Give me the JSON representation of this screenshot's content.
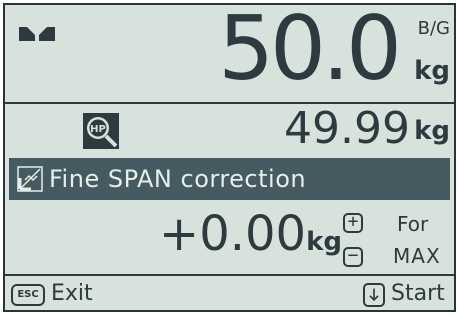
{
  "main_display": {
    "weight": "50.0",
    "mode": "B/G",
    "unit": "kg",
    "indicator_icon": "stable-indicator-icon"
  },
  "secondary_display": {
    "icon": "high-precision-magnifier-icon",
    "weight": "49.99",
    "unit": "kg"
  },
  "menu": {
    "icon": "span-adjust-icon",
    "title": "Fine SPAN correction"
  },
  "correction": {
    "value": "+0.00",
    "unit": "kg",
    "plus_key": "+",
    "minus_key": "−",
    "for_label": "For",
    "target_label": "MAX"
  },
  "softkeys": {
    "left_key": "ESC",
    "left_label": "Exit",
    "left_icon": "esc-key-icon",
    "right_icon": "down-arrow-key-icon",
    "right_label": "Start"
  },
  "colors": {
    "lcd_background": "#d8e2dc",
    "foreground": "#2e3a3f",
    "highlight_bar": "#455a61"
  }
}
